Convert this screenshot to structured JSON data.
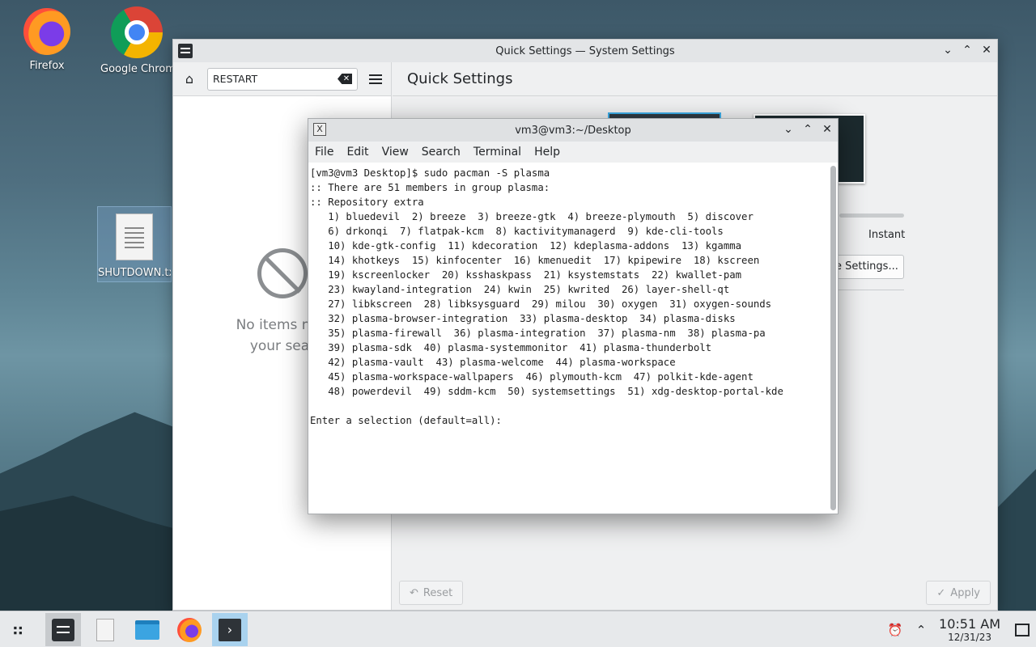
{
  "desktop": {
    "icons": [
      {
        "label": "Firefox"
      },
      {
        "label": "Google Chrom"
      },
      {
        "label": "SHUTDOWN.tx"
      }
    ]
  },
  "settings_window": {
    "title": "Quick Settings — System Settings",
    "search_value": "RESTART",
    "page_title": "Quick Settings",
    "no_items_line1": "No items mat",
    "no_items_line2": "your sear",
    "instant_label": "Instant",
    "more_settings_label": "e Settings...",
    "reset_label": "Reset",
    "apply_label": "Apply"
  },
  "terminal": {
    "title": "vm3@vm3:~/Desktop",
    "menu": [
      "File",
      "Edit",
      "View",
      "Search",
      "Terminal",
      "Help"
    ],
    "lines": [
      "[vm3@vm3 Desktop]$ sudo pacman -S plasma",
      ":: There are 51 members in group plasma:",
      ":: Repository extra",
      "   1) bluedevil  2) breeze  3) breeze-gtk  4) breeze-plymouth  5) discover",
      "   6) drkonqi  7) flatpak-kcm  8) kactivitymanagerd  9) kde-cli-tools",
      "   10) kde-gtk-config  11) kdecoration  12) kdeplasma-addons  13) kgamma",
      "   14) khotkeys  15) kinfocenter  16) kmenuedit  17) kpipewire  18) kscreen",
      "   19) kscreenlocker  20) ksshaskpass  21) ksystemstats  22) kwallet-pam",
      "   23) kwayland-integration  24) kwin  25) kwrited  26) layer-shell-qt",
      "   27) libkscreen  28) libksysguard  29) milou  30) oxygen  31) oxygen-sounds",
      "   32) plasma-browser-integration  33) plasma-desktop  34) plasma-disks",
      "   35) plasma-firewall  36) plasma-integration  37) plasma-nm  38) plasma-pa",
      "   39) plasma-sdk  40) plasma-systemmonitor  41) plasma-thunderbolt",
      "   42) plasma-vault  43) plasma-welcome  44) plasma-workspace",
      "   45) plasma-workspace-wallpapers  46) plymouth-kcm  47) polkit-kde-agent",
      "   48) powerdevil  49) sddm-kcm  50) systemsettings  51) xdg-desktop-portal-kde",
      "",
      "Enter a selection (default=all):"
    ]
  },
  "taskbar": {
    "time": "10:51 AM",
    "date": "12/31/23"
  }
}
